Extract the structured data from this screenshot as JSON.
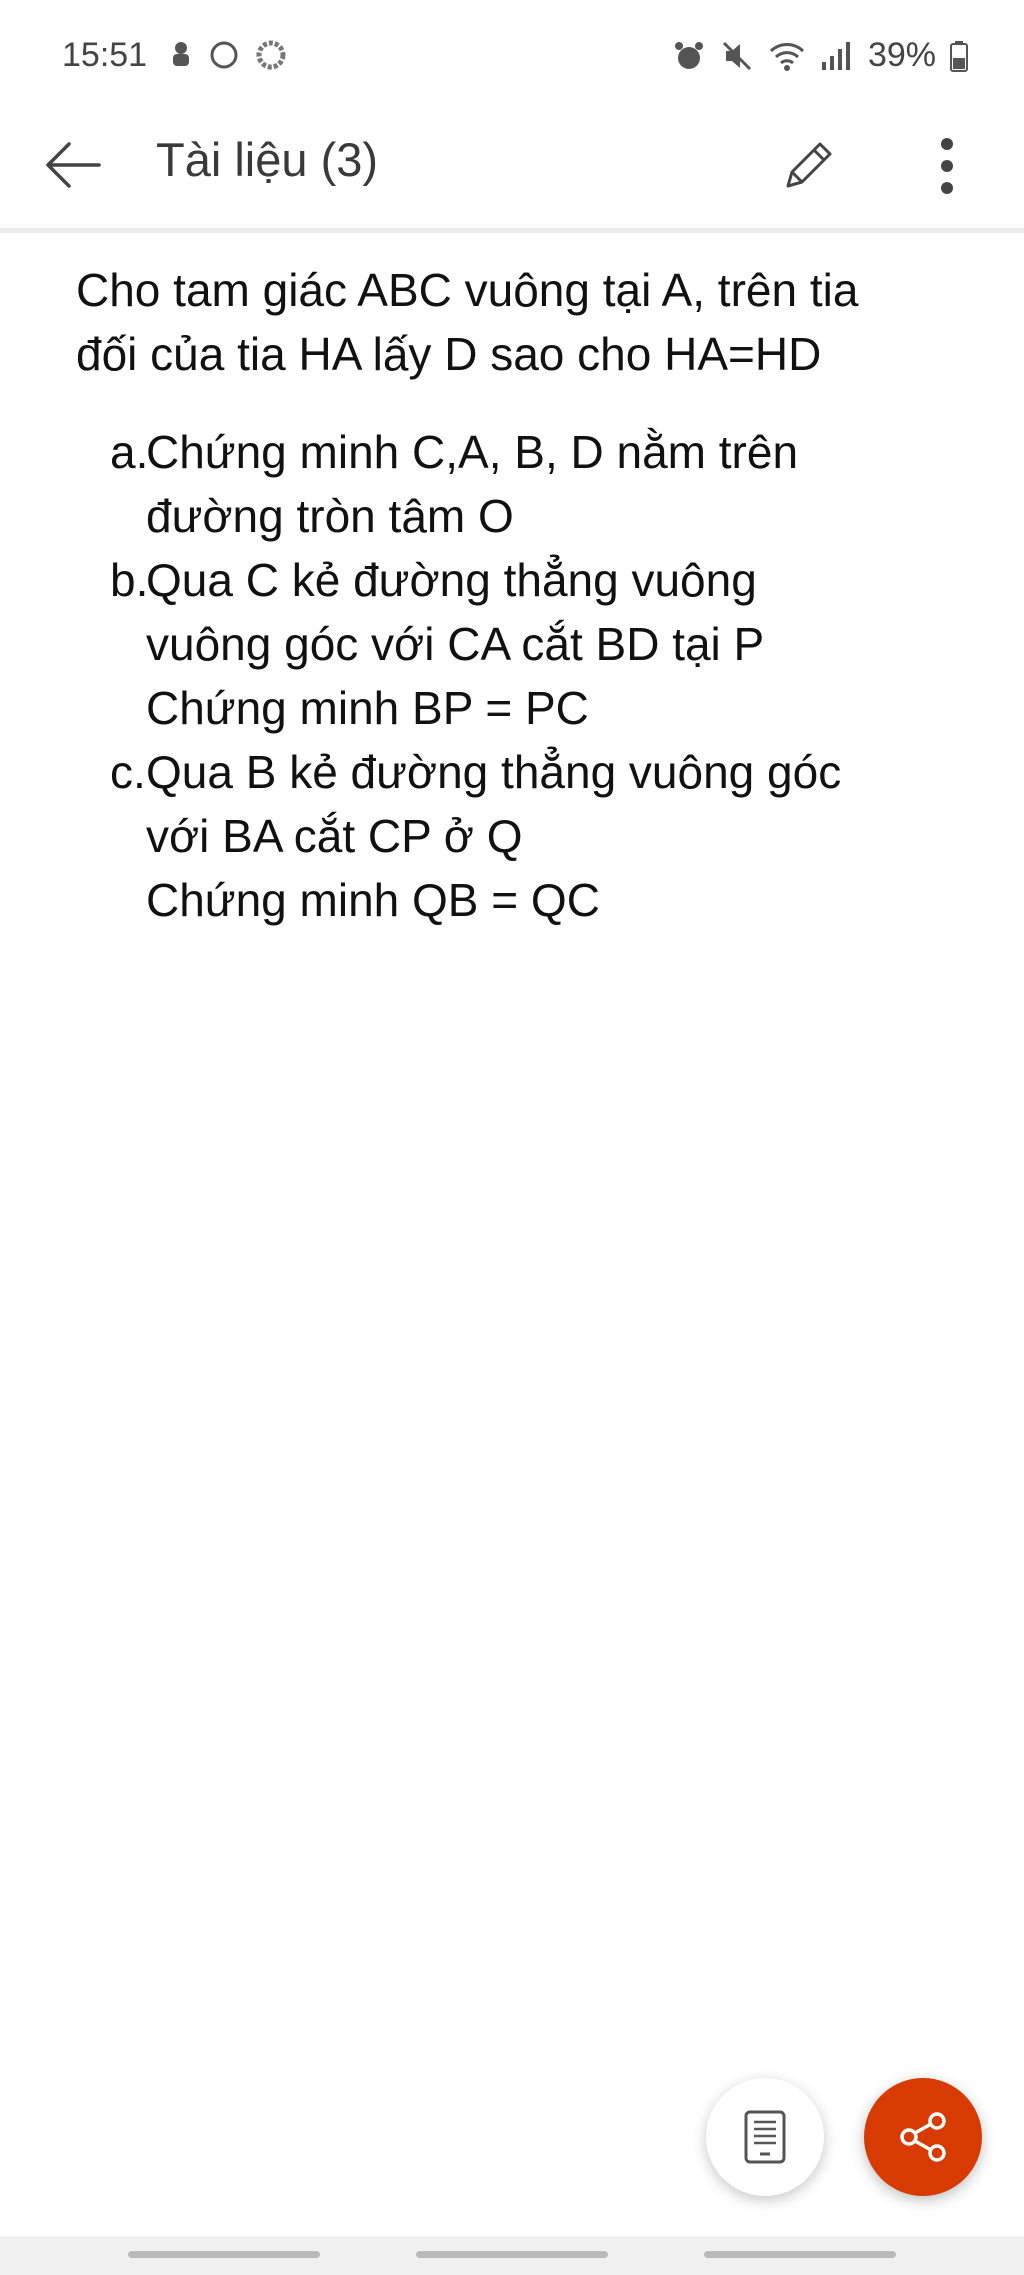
{
  "status_bar": {
    "time": "15:51",
    "left_icons": [
      "notification-icon",
      "circle-icon",
      "ring-icon"
    ],
    "right_icons": [
      "alarm-icon",
      "mute-icon",
      "wifi-icon",
      "signal-icon"
    ],
    "battery": "39%"
  },
  "app_bar": {
    "title": "Tài liệu (3)",
    "icons": [
      "back-arrow-icon",
      "pencil-icon",
      "more-vertical-icon"
    ]
  },
  "document": {
    "intro_line1": "Cho tam giác ABC vuông tại A, trên tia",
    "intro_line2": "đối của tia HA lấy D sao cho HA=HD",
    "items": [
      {
        "marker": "a.",
        "lines": [
          "Chứng minh C,A, B, D nằm trên",
          "đường tròn tâm O"
        ]
      },
      {
        "marker": "b.",
        "lines": [
          "Qua C kẻ đường thẳng vuông",
          "vuông góc với CA cắt BD tại P",
          "Chứng minh BP = PC"
        ]
      },
      {
        "marker": "c.",
        "lines": [
          "Qua B kẻ đường thẳng vuông góc",
          "với BA cắt CP ở Q",
          "Chứng minh QB = QC"
        ]
      }
    ]
  },
  "fabs": {
    "view_icon": "reading-view-icon",
    "share_icon": "share-icon"
  },
  "colors": {
    "accent": "#d83b01",
    "text": "#111111",
    "divider": "#ececec"
  }
}
